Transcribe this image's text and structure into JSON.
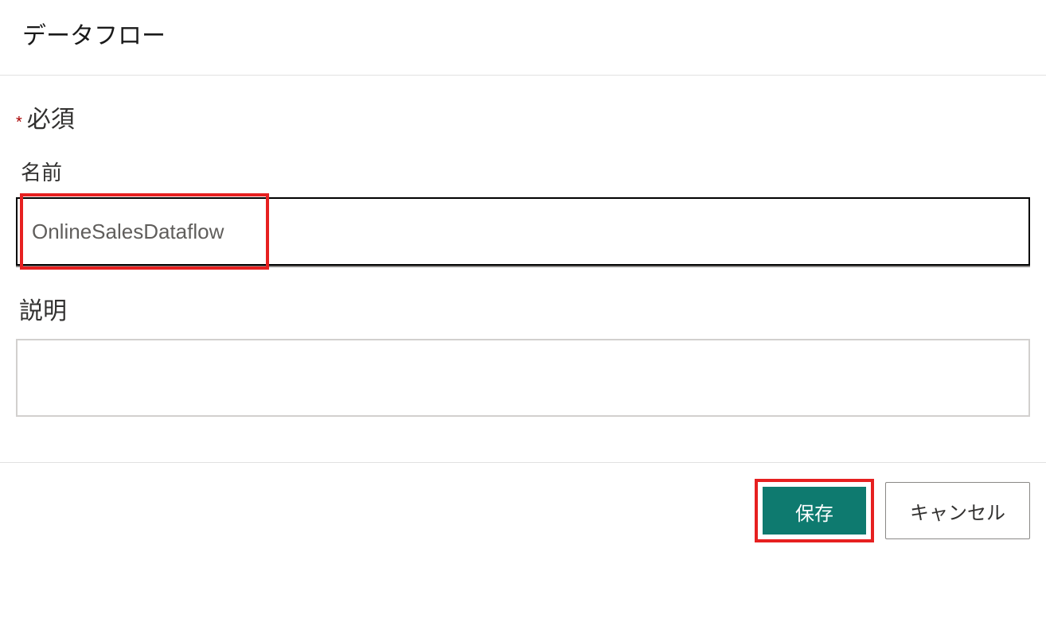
{
  "header": {
    "title": "データフロー"
  },
  "form": {
    "required_label": "必須",
    "required_asterisk": "*",
    "name_label": "名前",
    "name_value": "OnlineSalesDataflow",
    "description_label": "説明",
    "description_value": ""
  },
  "footer": {
    "save_label": "保存",
    "cancel_label": "キャンセル"
  }
}
